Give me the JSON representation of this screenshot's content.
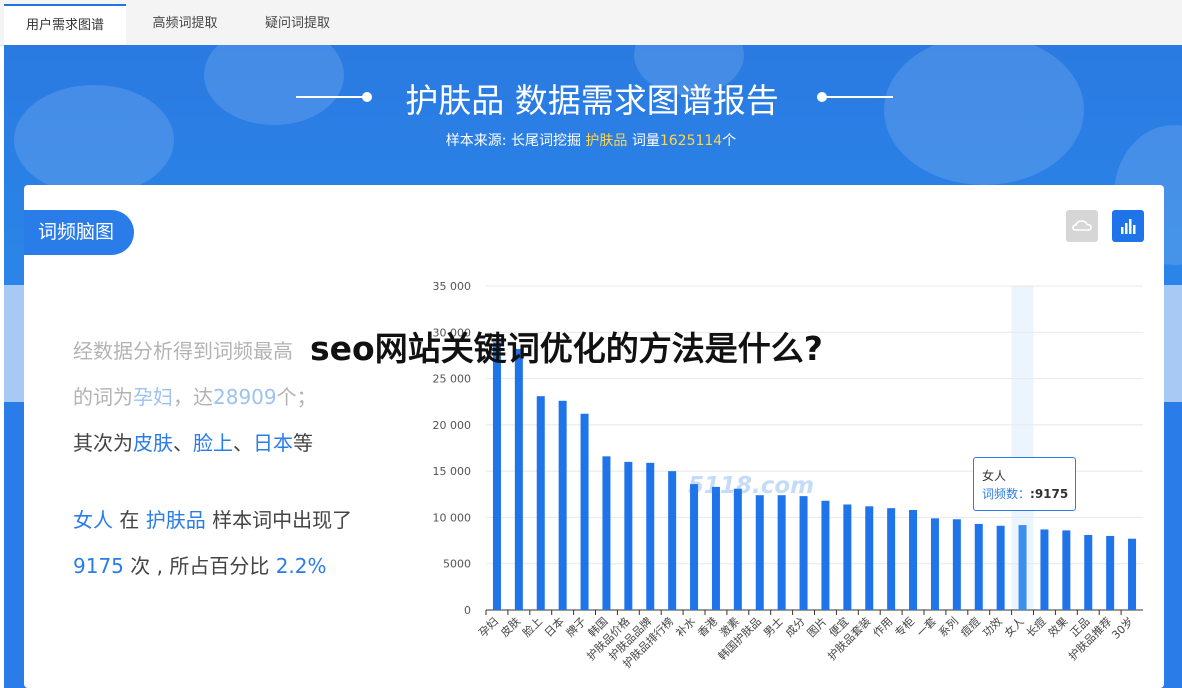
{
  "tabs": [
    {
      "label": "用户需求图谱",
      "active": true
    },
    {
      "label": "高频词提取",
      "active": false
    },
    {
      "label": "疑问词提取",
      "active": false
    }
  ],
  "header": {
    "title": "护肤品 数据需求图谱报告",
    "source_label": "样本来源:",
    "source_tool": "长尾词挖掘",
    "keyword": "护肤品",
    "volume_label": "词量",
    "volume": "1625114",
    "volume_unit": "个"
  },
  "section": {
    "title": "词频脑图",
    "buttons": [
      {
        "icon": "cloud-icon"
      },
      {
        "icon": "bar-chart-icon"
      }
    ]
  },
  "summary": {
    "line1": "经数据分析得到词频最高",
    "line2_pre": "的词为",
    "top_word": "孕妇",
    "line2_mid": "，达",
    "top_count": "28909",
    "line2_post": "个；",
    "line3_pre": "其次为",
    "second": "皮肤",
    "sep1": "、",
    "third": "脸上",
    "sep2": "、",
    "fourth": "日本",
    "line3_post": "等",
    "sel_word": "女人",
    "line4_mid": "在",
    "sel_sample": "护肤品",
    "line4_post": "样本词中出现了",
    "sel_count": "9175",
    "line5_mid": "次 , 所占百分比",
    "sel_pct": "2.2%"
  },
  "overlay_text": "seo网站关键词优化的方法是什么?",
  "watermark": "5118.com",
  "tooltip": {
    "word": "女人",
    "label": "词频数：",
    "value": ":9175"
  },
  "colors": {
    "accent": "#2a7de9",
    "bar": "#1e74e8",
    "highlight": "#ffd54a"
  },
  "chart_data": {
    "type": "bar",
    "categories": [
      "孕妇",
      "皮肤",
      "脸上",
      "日本",
      "牌子",
      "韩国",
      "护肤品价格",
      "护肤品品牌",
      "护肤品排行榜",
      "补水",
      "香港",
      "激素",
      "韩国护肤品",
      "男士",
      "成分",
      "图片",
      "便宜",
      "护肤品套装",
      "作用",
      "专柜",
      "一套",
      "系列",
      "痘痘",
      "功效",
      "女人",
      "长痘",
      "效果",
      "正品",
      "护肤品推荐",
      "30岁"
    ],
    "series": [
      {
        "values": [
          28909,
          28200,
          23100,
          22600,
          21200,
          16600,
          16000,
          15900,
          15000,
          13600,
          13300,
          13100,
          12400,
          12400,
          12300,
          11800,
          11400,
          11200,
          11000,
          10800,
          9900,
          9800,
          9300,
          9100,
          9175,
          8700,
          8600,
          8100,
          8000,
          7700
        ]
      }
    ],
    "ylim": [
      0,
      35000
    ],
    "yticks": [
      "0",
      "5000",
      "10 000",
      "15 000",
      "20 000",
      "25 000",
      "30 000",
      "35 000"
    ],
    "highlight_index": 24,
    "grid": true
  }
}
